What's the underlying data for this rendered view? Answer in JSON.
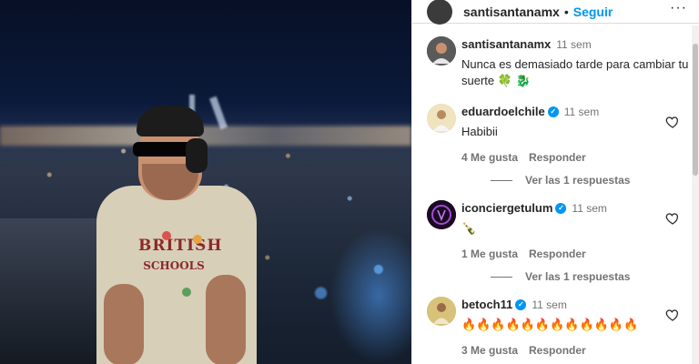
{
  "post": {
    "author": "santisantanamx",
    "follow_label": "Seguir",
    "more_label": "···",
    "shirt_text_line1": "BRITISH",
    "shirt_text_line2": "SCHOOLS"
  },
  "comments": [
    {
      "user": "santisantanamx",
      "verified": false,
      "time": "11 sem",
      "text": "Nunca es demasiado tarde para cambiar tu suerte 🍀 🐉",
      "likes": "",
      "reply_label": "",
      "view_replies": "",
      "avatar_color": "#3b3b3b"
    },
    {
      "user": "eduardoelchile",
      "verified": true,
      "time": "11 sem",
      "text": "Habibii",
      "likes": "4 Me gusta",
      "reply_label": "Responder",
      "view_replies": "Ver las 1 respuestas",
      "avatar_color": "#e9d9a8"
    },
    {
      "user": "iconciergetulum",
      "verified": true,
      "time": "11 sem",
      "text": "🍾",
      "likes": "1 Me gusta",
      "reply_label": "Responder",
      "view_replies": "Ver las 1 respuestas",
      "avatar_color": "#1a0a22"
    },
    {
      "user": "betoch11",
      "verified": true,
      "time": "11 sem",
      "text": "🔥🔥🔥🔥🔥🔥🔥🔥🔥🔥🔥🔥",
      "likes": "3 Me gusta",
      "reply_label": "Responder",
      "view_replies": "",
      "avatar_color": "#c9b36a"
    }
  ],
  "icons": {
    "heart": "heart-icon",
    "verified": "verified-badge-icon",
    "more": "more-options-icon"
  },
  "colors": {
    "accent": "#0095f6",
    "muted": "#737373",
    "text": "#262626"
  }
}
